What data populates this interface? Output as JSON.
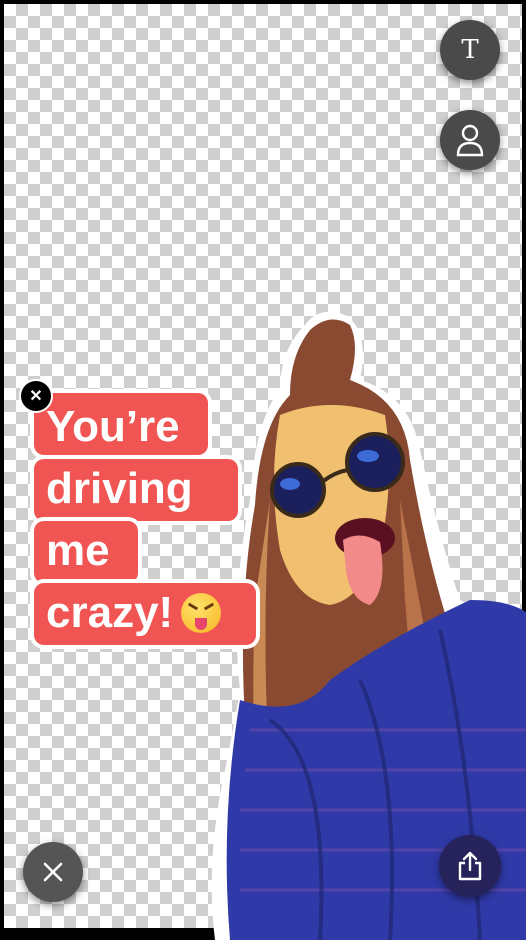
{
  "toolbar": {
    "text_tool_label": "T",
    "text_tool_icon": "text-icon",
    "sticker_tool_icon": "person-icon"
  },
  "sticker_text": {
    "line1": "You’re",
    "line2": "driving",
    "line3": "me",
    "line4": "crazy!",
    "emoji_icon": "squinting-face-with-tongue-icon",
    "background_color": "#f05553",
    "delete_icon": "close-icon"
  },
  "bottom_bar": {
    "close_icon": "close-icon",
    "share_icon": "share-icon"
  },
  "colors": {
    "button_dark": "#4a4a4a",
    "share_button": "#26225a",
    "text_bubble": "#f05553"
  }
}
